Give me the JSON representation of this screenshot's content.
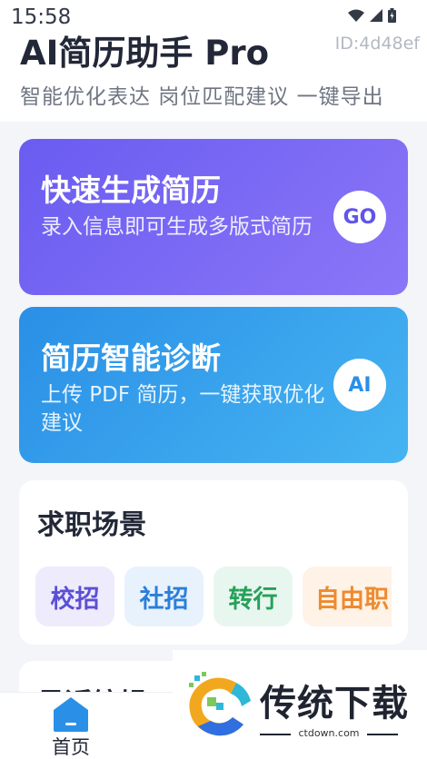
{
  "status_bar": {
    "time": "15:58",
    "icons": [
      "wifi-icon",
      "signal-icon",
      "battery-icon"
    ]
  },
  "header": {
    "title": "AI简历助手 Pro",
    "device_id": "ID:4d48ef",
    "subtitle": "智能优化表达 岗位匹配建议 一键导出"
  },
  "cards": [
    {
      "title": "快速生成简历",
      "description": "录入信息即可生成多版式简历",
      "badge": "GO"
    },
    {
      "title": "简历智能诊断",
      "description": "上传 PDF 简历，一键获取优化建议",
      "badge": "AI"
    }
  ],
  "scenes": {
    "title": "求职场景",
    "chips": [
      "校招",
      "社招",
      "转行",
      "自由职"
    ]
  },
  "recent": {
    "title": "最近编辑"
  },
  "bottom_nav": {
    "items": [
      {
        "label": "首页",
        "icon": "home-icon",
        "active": true
      }
    ]
  },
  "watermark": {
    "text": "传统下载",
    "url": "ctdown.com"
  },
  "colors": {
    "card_1": "#6a5cf1",
    "card_2": "#2a8fe6",
    "nav_active": "#2a8fe6"
  }
}
